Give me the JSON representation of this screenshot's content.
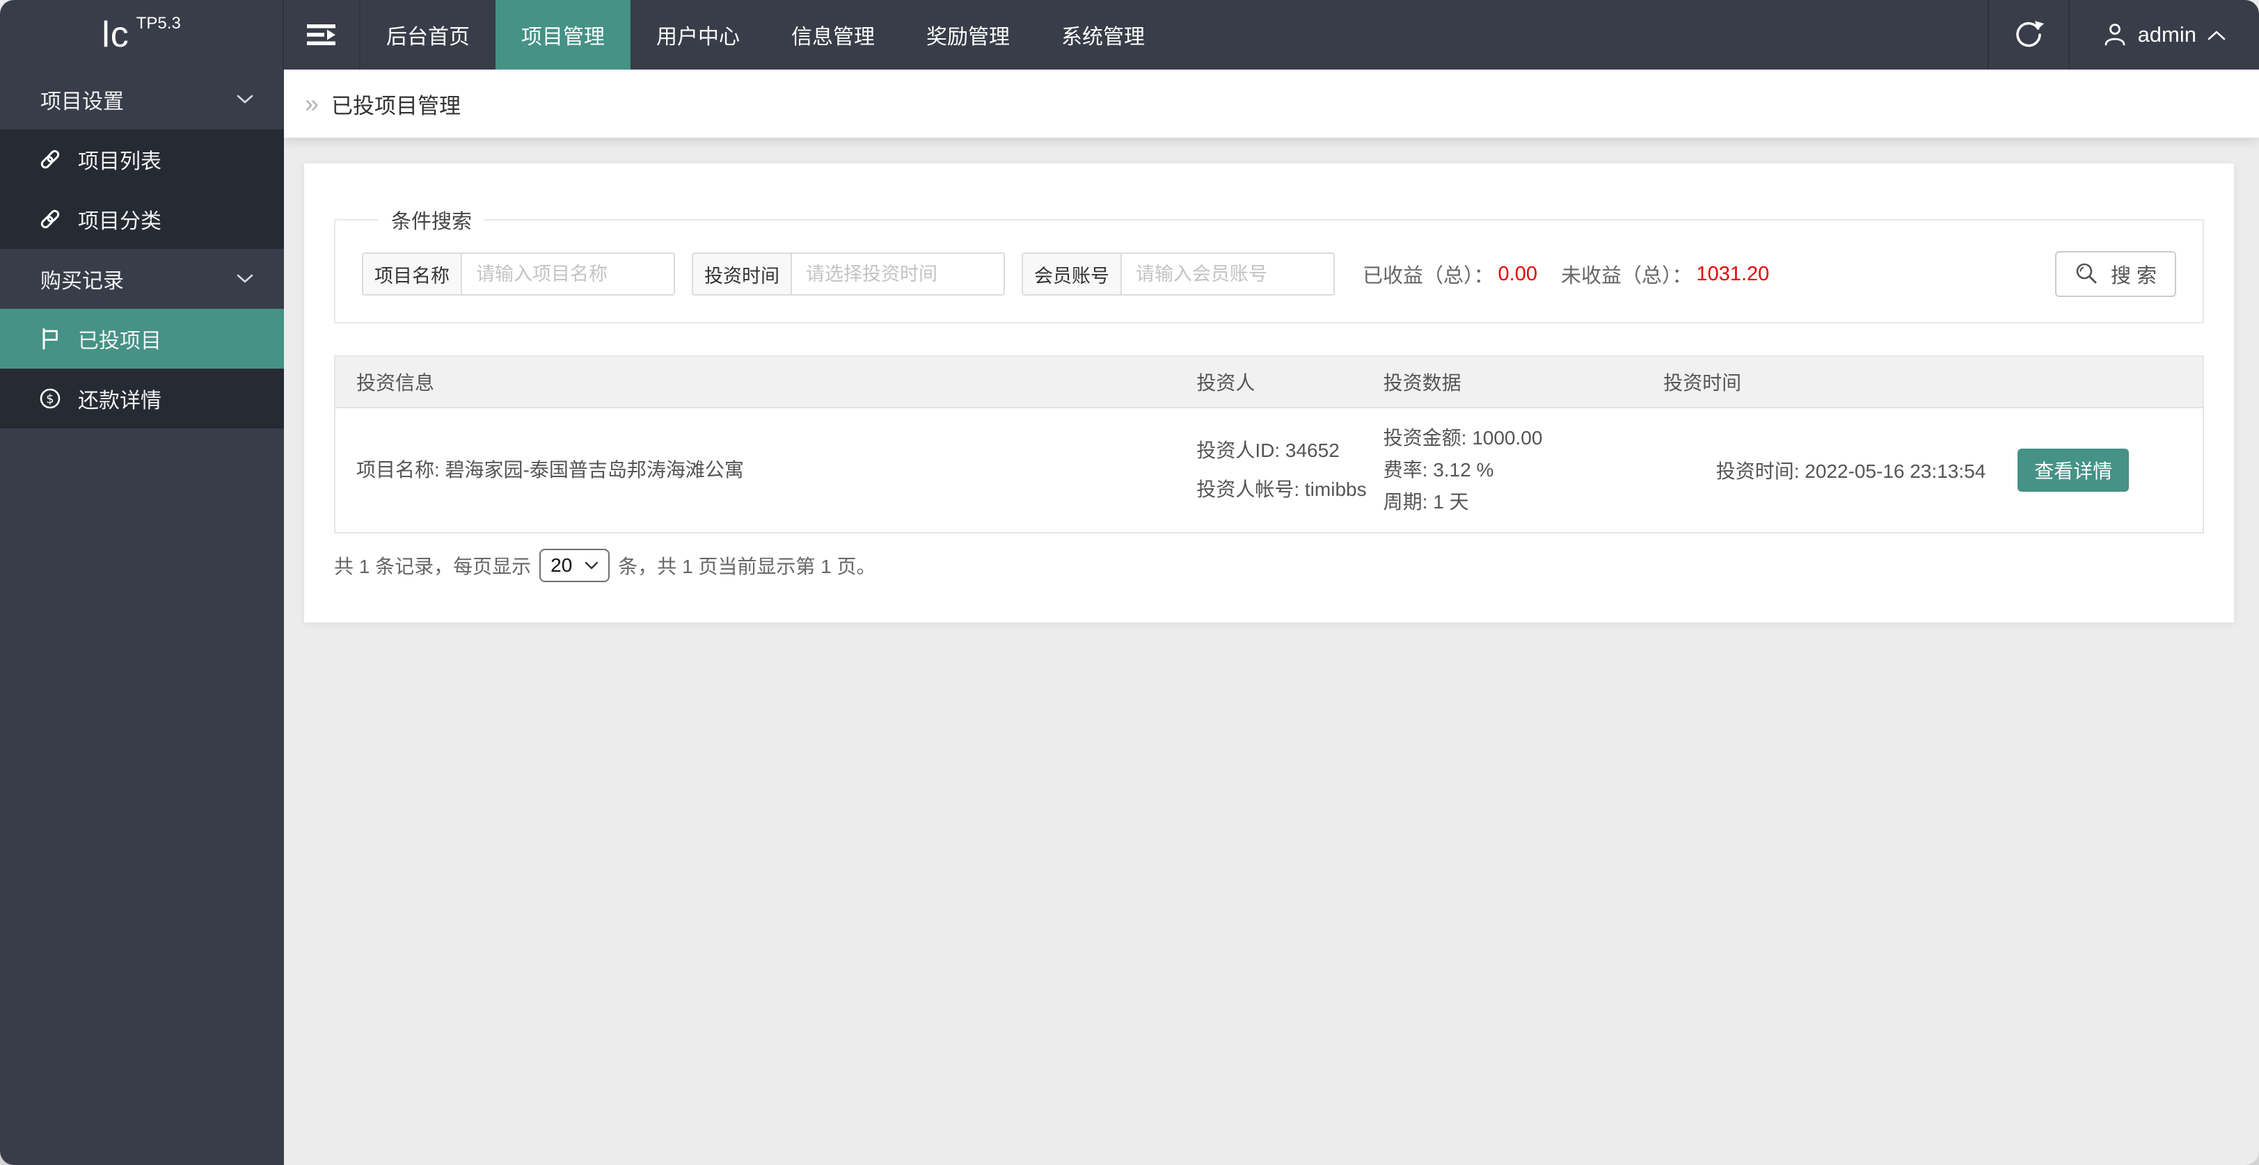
{
  "header": {
    "logo_text": "lc",
    "logo_badge": "TP5.3",
    "tabs": [
      {
        "label": "后台首页"
      },
      {
        "label": "项目管理"
      },
      {
        "label": "用户中心"
      },
      {
        "label": "信息管理"
      },
      {
        "label": "奖励管理"
      },
      {
        "label": "系统管理"
      }
    ],
    "active_tab": "项目管理",
    "user_name": "admin"
  },
  "sidebar": {
    "items": [
      {
        "label": "项目设置",
        "type": "group",
        "icon": "chevron-down-icon"
      },
      {
        "label": "项目列表",
        "type": "item",
        "icon": "link-icon"
      },
      {
        "label": "项目分类",
        "type": "item",
        "icon": "link-icon"
      },
      {
        "label": "购买记录",
        "type": "group",
        "icon": "chevron-down-icon"
      },
      {
        "label": "已投项目",
        "type": "item",
        "icon": "flag-icon",
        "active": true
      },
      {
        "label": "还款详情",
        "type": "item",
        "icon": "dollar-circle-icon"
      }
    ]
  },
  "breadcrumb": {
    "title": "已投项目管理"
  },
  "search": {
    "legend": "条件搜索",
    "fields": [
      {
        "label": "项目名称",
        "placeholder": "请输入项目名称"
      },
      {
        "label": "投资时间",
        "placeholder": "请选择投资时间"
      },
      {
        "label": "会员账号",
        "placeholder": "请输入会员账号"
      }
    ],
    "stats": [
      {
        "label": "已收益（总）：",
        "value": "0.00"
      },
      {
        "label": "未收益（总）：",
        "value": "1031.20"
      }
    ],
    "button_label": "搜 索"
  },
  "table": {
    "headers": [
      "投资信息",
      "投资人",
      "投资数据",
      "投资时间"
    ],
    "row": {
      "project": "项目名称: 碧海家园-泰国普吉岛邦涛海滩公寓",
      "investor": [
        "投资人ID: 34652",
        "投资人帐号: timibbs"
      ],
      "data": [
        "投资金额: 1000.00",
        "费率: 3.12 %",
        "周期: 1 天"
      ],
      "time": "投资时间: 2022-05-16 23:13:54",
      "action": "查看详情"
    }
  },
  "pagination": {
    "before": "共 1 条记录，每页显示",
    "page_size": "20",
    "after": "条，共 1 页当前显示第 1 页。"
  },
  "colors": {
    "accent": "#459286",
    "navbar": "#393d49",
    "submenu": "#262a33",
    "danger": "#e60000",
    "page_bg": "#ececec"
  }
}
